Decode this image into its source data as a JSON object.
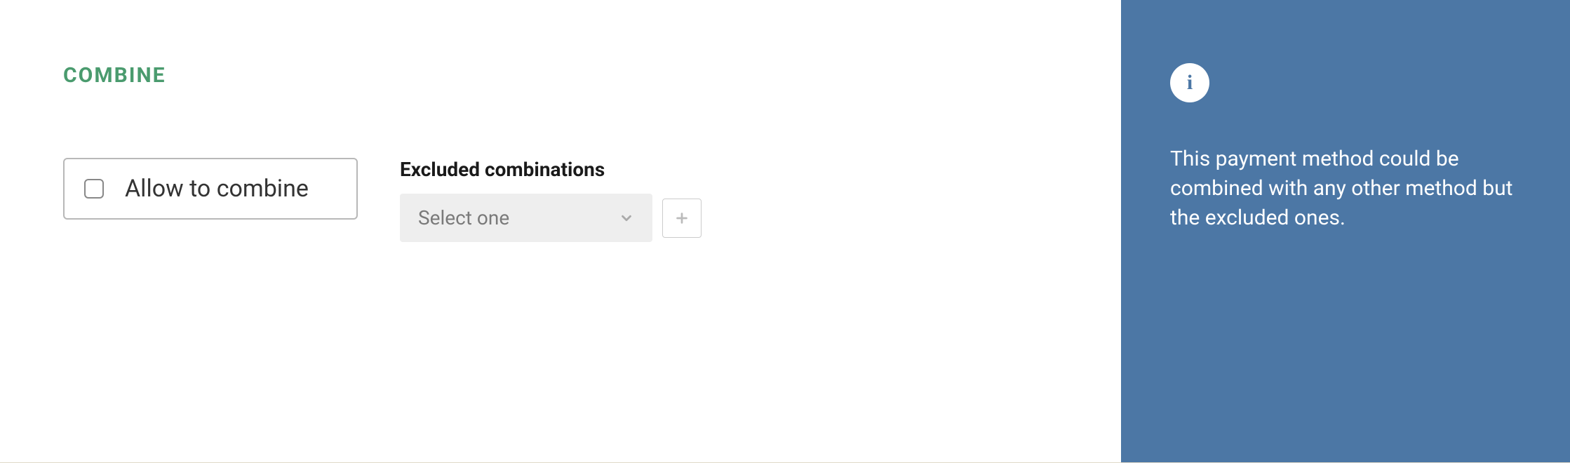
{
  "section": {
    "title": "COMBINE"
  },
  "checkbox": {
    "label": "Allow to combine",
    "checked": false
  },
  "excluded": {
    "label": "Excluded combinations",
    "placeholder": "Select one"
  },
  "info": {
    "text": "This payment method could be combined with any other method but the excluded ones."
  }
}
